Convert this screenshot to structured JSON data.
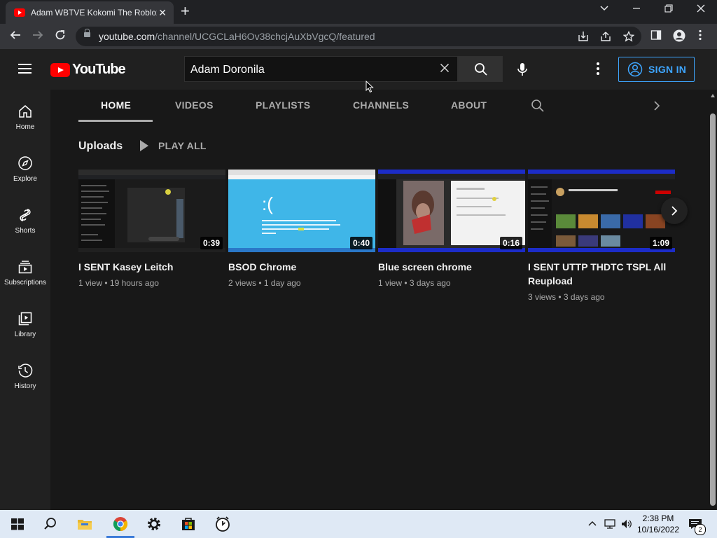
{
  "browser": {
    "tab_title": "Adam WBTVE Kokomi The Roblox",
    "tab_close": "✕",
    "new_tab": "+",
    "url_host": "youtube.com",
    "url_path": "/channel/UCGCLaH6Ov38chcjAuXbVgcQ/featured",
    "window_controls": {
      "dropdown": "⌄",
      "minimize": "–",
      "restore": "❐",
      "close": "✕"
    }
  },
  "masthead": {
    "logo_text": "YouTube",
    "search_value": "Adam Doronila",
    "search_clear": "✕",
    "signin_label": "SIGN IN",
    "brand_red": "#ff0000",
    "accent_blue": "#3ea6ff"
  },
  "guide": {
    "items": [
      {
        "label": "Home",
        "icon": "home-icon"
      },
      {
        "label": "Explore",
        "icon": "compass-icon"
      },
      {
        "label": "Shorts",
        "icon": "shorts-icon"
      },
      {
        "label": "Subscriptions",
        "icon": "subscriptions-icon"
      },
      {
        "label": "Library",
        "icon": "library-icon"
      },
      {
        "label": "History",
        "icon": "history-icon"
      }
    ]
  },
  "channel_tabs": [
    {
      "label": "HOME",
      "active": true
    },
    {
      "label": "VIDEOS",
      "active": false
    },
    {
      "label": "PLAYLISTS",
      "active": false
    },
    {
      "label": "CHANNELS",
      "active": false
    },
    {
      "label": "ABOUT",
      "active": false
    }
  ],
  "shelf": {
    "title": "Uploads",
    "play_all": "PLAY ALL",
    "videos": [
      {
        "title": "I SENT Kasey Leitch",
        "duration": "0:39",
        "views": "1 view",
        "age": "19 hours ago"
      },
      {
        "title": "BSOD Chrome",
        "duration": "0:40",
        "views": "2 views",
        "age": "1 day ago"
      },
      {
        "title": "Blue screen chrome",
        "duration": "0:16",
        "views": "1 view",
        "age": "3 days ago"
      },
      {
        "title": "I SENT UTTP THDTC TSPL All Reupload",
        "duration": "1:09",
        "views": "3 views",
        "age": "3 days ago"
      }
    ],
    "meta_separator": " • "
  },
  "taskbar": {
    "time": "2:38 PM",
    "date": "10/16/2022",
    "notification_count": "2"
  }
}
